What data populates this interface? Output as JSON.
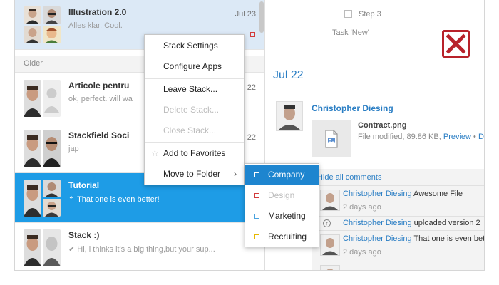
{
  "list": {
    "top_row": {
      "title": "Illustration 2.0",
      "subtitle": "Alles klar. Cool.",
      "date": "Jul 23"
    },
    "section_label": "Older",
    "rows": [
      {
        "title": "Articole pentru",
        "subtitle": "ok, perfect. will wa",
        "date": "Jul 22"
      },
      {
        "title": "Stackfield Soci",
        "subtitle": "jap",
        "date": "Jul 22"
      },
      {
        "title": "Tutorial",
        "subtitle": "↰ That one is even better!",
        "date": ""
      },
      {
        "title": "Stack :)",
        "subtitle": "✔ Hi, i thinks it's a big thing,but your sup...",
        "date": ""
      }
    ]
  },
  "context_menu": {
    "items": [
      {
        "label": "Stack Settings",
        "disabled": false
      },
      {
        "label": "Configure Apps",
        "disabled": false
      },
      {
        "label": "Leave Stack...",
        "disabled": false
      },
      {
        "label": "Delete Stack...",
        "disabled": true
      },
      {
        "label": "Close Stack...",
        "disabled": true
      },
      {
        "label": "Add to Favorites",
        "disabled": false,
        "icon": "star-icon"
      },
      {
        "label": "Move to Folder",
        "disabled": false,
        "icon": "chevron-right-icon"
      }
    ],
    "arrow_glyph": "›",
    "star_glyph": "☆"
  },
  "submenu": {
    "items": [
      {
        "label": "Company",
        "color": "#1e85cf"
      },
      {
        "label": "Design",
        "color": "#d23b3b"
      },
      {
        "label": "Marketing",
        "color": "#4aa3df"
      },
      {
        "label": "Recruiting",
        "color": "#e6b800"
      }
    ]
  },
  "detail": {
    "step_label": "Step 3",
    "task_label": "Task 'New'",
    "date_heading": "Jul 22",
    "poster": "Christopher Diesing",
    "file": {
      "name": "Contract.png",
      "meta": "File modified, 89.86 KB,",
      "preview": "Preview",
      "dot": " • ",
      "download": "Do"
    },
    "hide_comments": "Hide all comments",
    "comments": [
      {
        "author": "Christopher Diesing",
        "text": " Awesome File",
        "time": "2 days ago"
      },
      {
        "author": "Christopher Diesing",
        "text": " uploaded version 2",
        "time": ""
      },
      {
        "author": "Christopher Diesing",
        "text": " That one is even bett",
        "time": "2 days ago"
      }
    ]
  },
  "colors": {
    "accent": "#1e9ce6",
    "link": "#2a7ec4",
    "close_red": "#b8222a"
  }
}
